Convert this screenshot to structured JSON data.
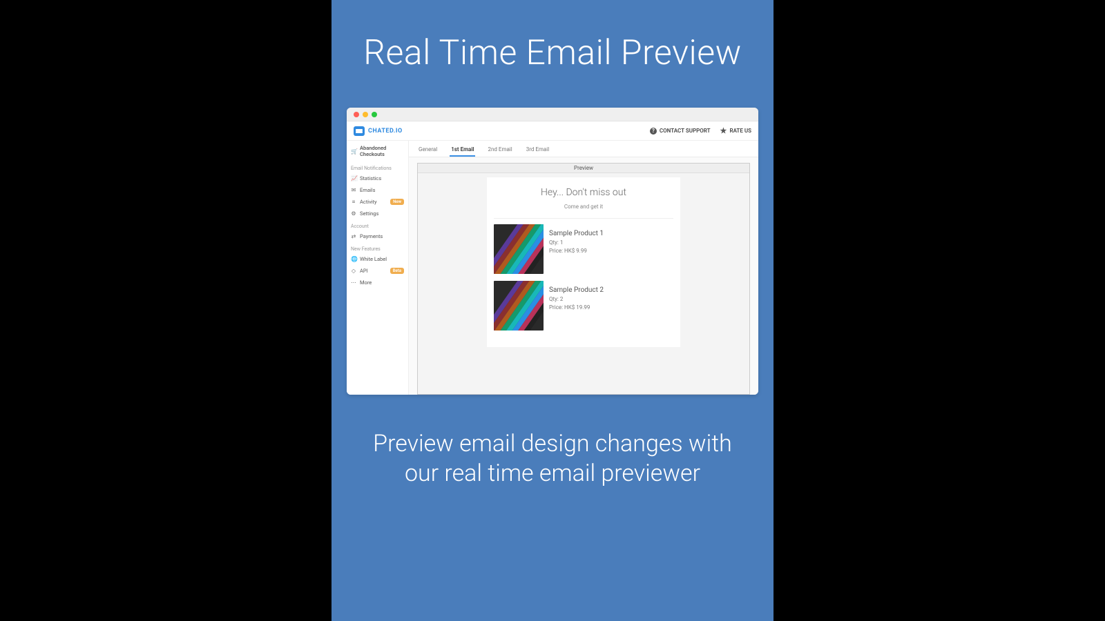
{
  "promo": {
    "title": "Real Time Email Preview",
    "subtitle": "Preview email design changes with our real time email previewer"
  },
  "brand": {
    "name": "CHATED.IO"
  },
  "header_actions": {
    "contact_support": "CONTACT SUPPORT",
    "rate_us": "RATE US"
  },
  "sidebar": {
    "abandoned_checkouts": "Abandoned Checkouts",
    "groups": {
      "email_notifications": "Email Notifications",
      "account": "Account",
      "new_features": "New Features"
    },
    "items": {
      "statistics": "Statistics",
      "emails": "Emails",
      "activity": "Activity",
      "settings": "Settings",
      "payments": "Payments",
      "white_label": "White Label",
      "api": "API",
      "more": "More"
    },
    "badges": {
      "new": "New",
      "beta": "Beta"
    }
  },
  "tabs": {
    "general": "General",
    "first": "1st Email",
    "second": "2nd Email",
    "third": "3rd Email"
  },
  "preview": {
    "label": "Preview",
    "email_title": "Hey... Don't miss out",
    "email_sub": "Come and get it",
    "products": [
      {
        "name": "Sample Product 1",
        "qty": "Qty: 1",
        "price": "Price: HK$ 9.99"
      },
      {
        "name": "Sample Product 2",
        "qty": "Qty: 2",
        "price": "Price: HK$ 19.99"
      }
    ]
  }
}
